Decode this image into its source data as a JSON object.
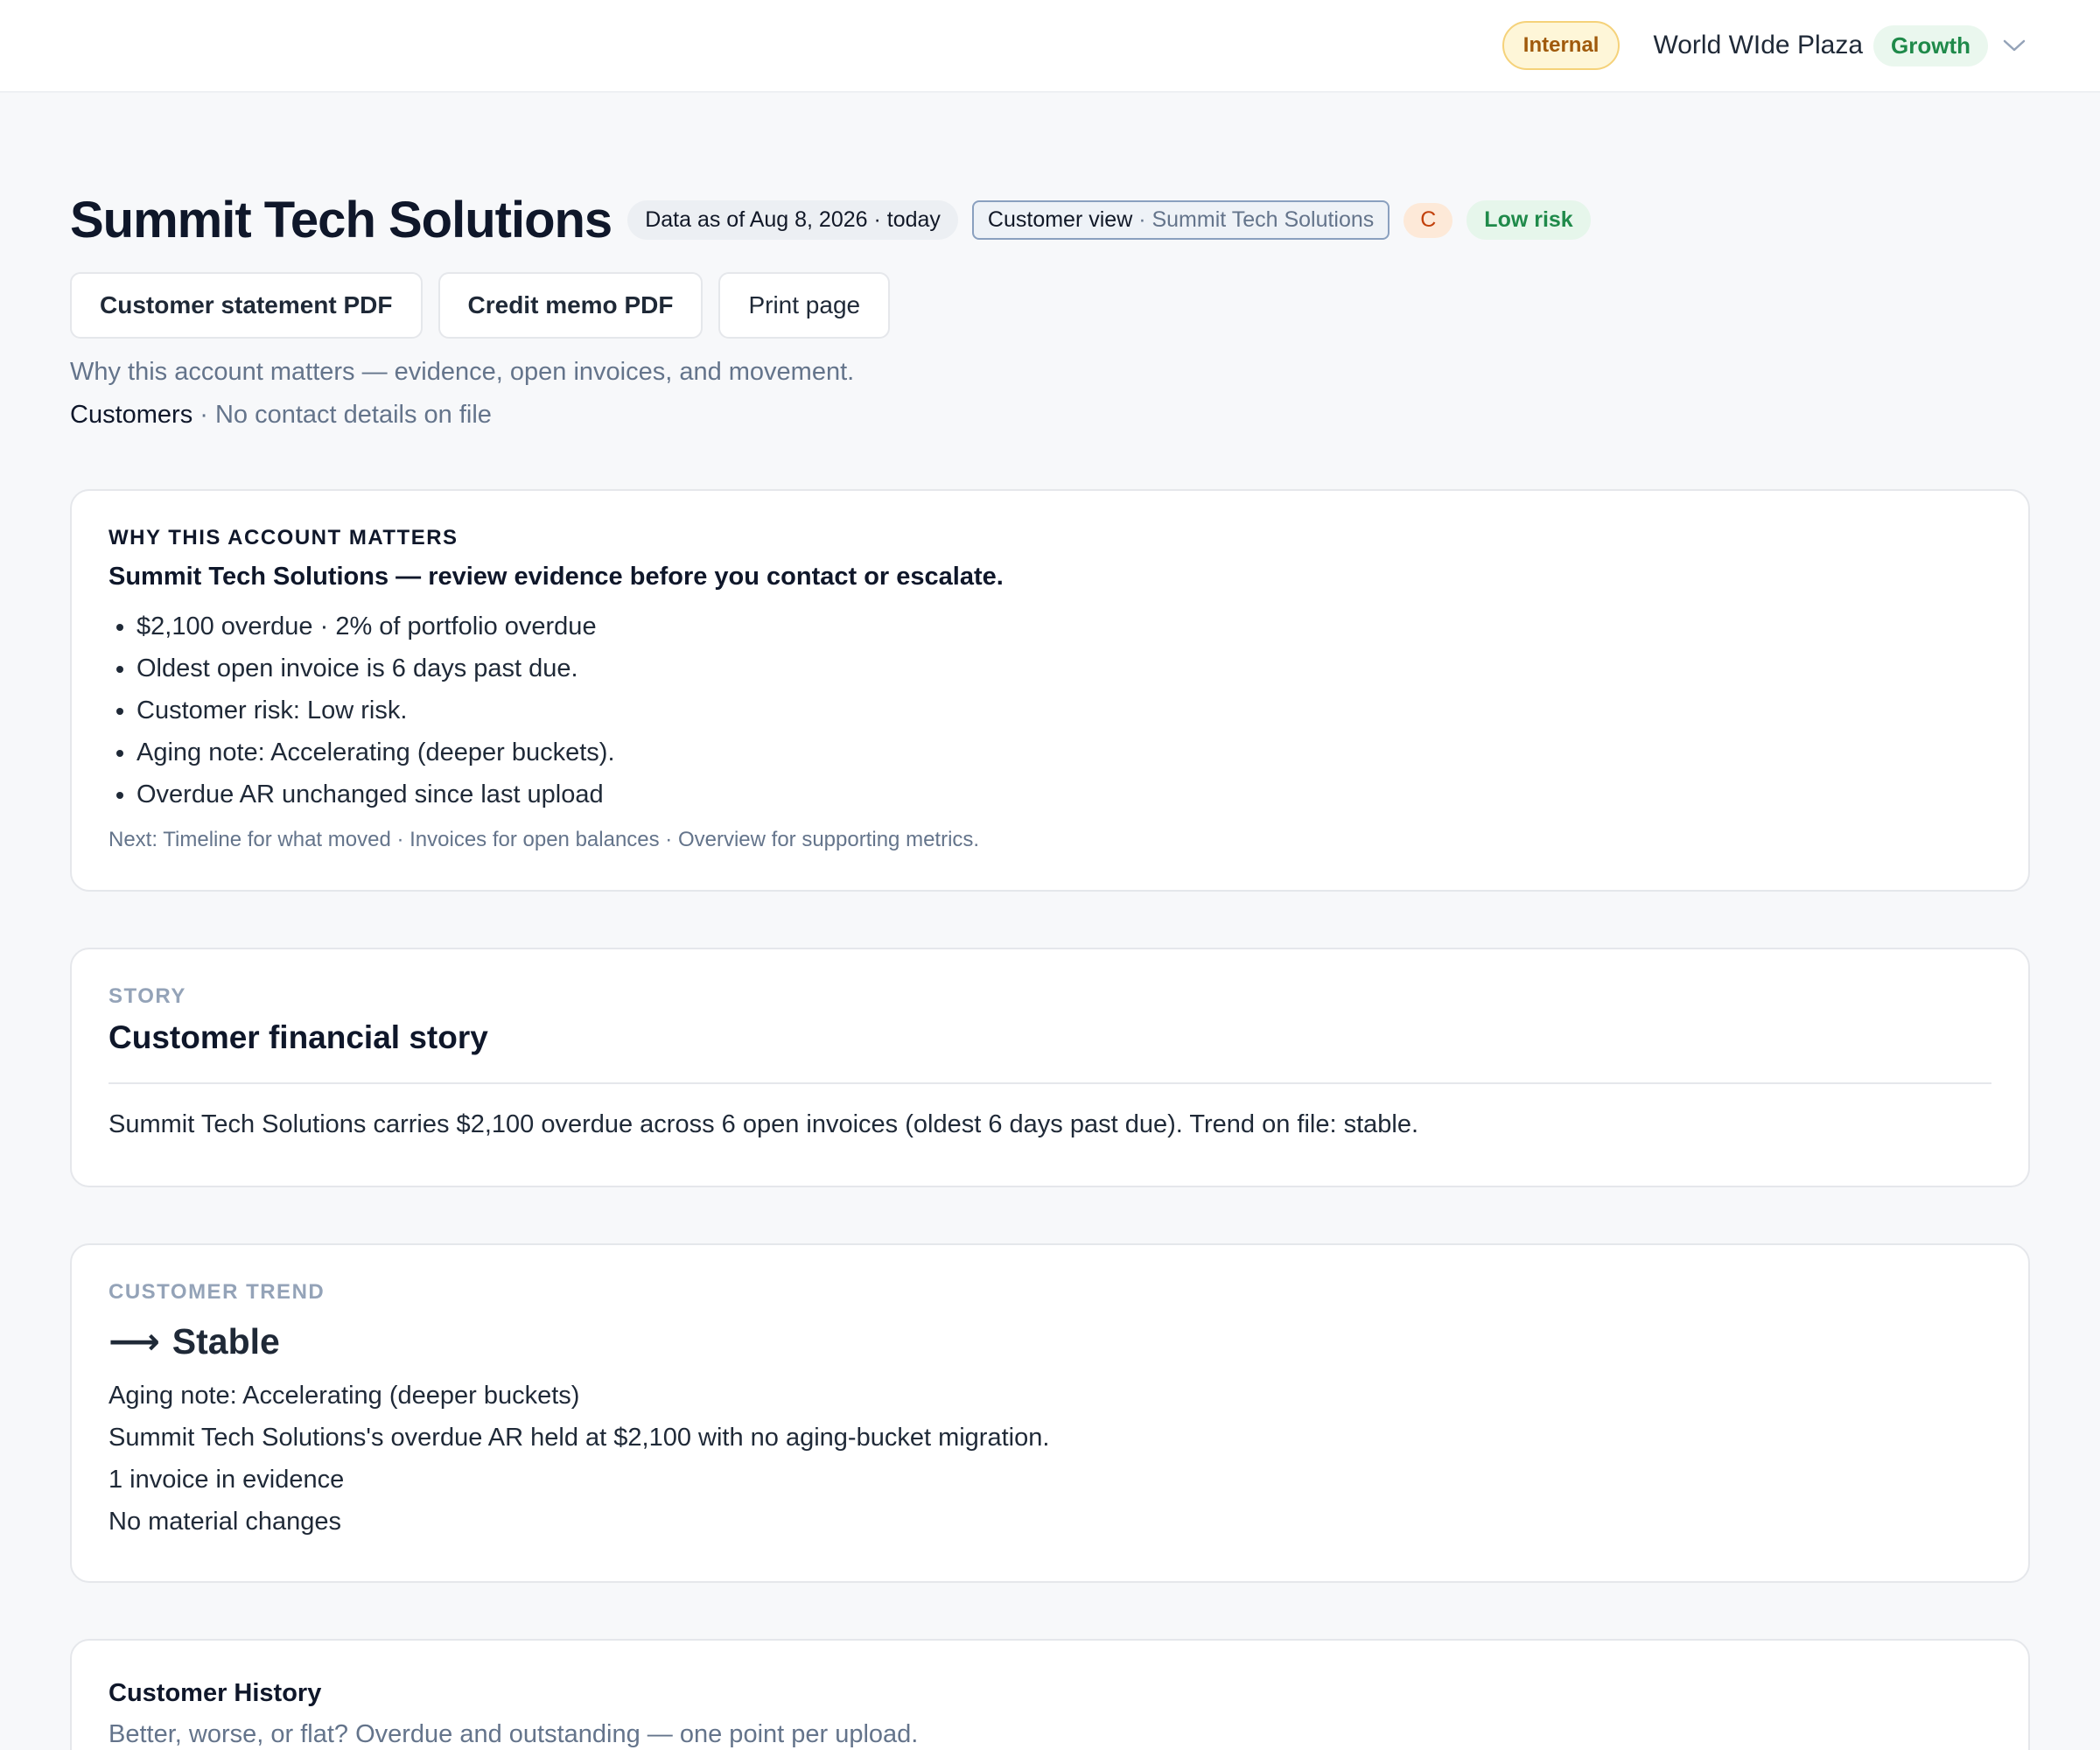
{
  "topbar": {
    "badge": "Internal",
    "org_name": "World WIde Plaza",
    "plan": "Growth",
    "menu_icon": "chevron-down-icon"
  },
  "header": {
    "title": "Summit Tech Solutions",
    "data_as_of": "Data as of Aug 8, 2026 · today",
    "view_label": "Customer view",
    "view_customer": " · Summit Tech Solutions",
    "grade": "C",
    "risk": "Low risk"
  },
  "actions": {
    "statement_pdf": "Customer statement PDF",
    "credit_memo_pdf": "Credit memo PDF",
    "print_page": "Print page"
  },
  "intro": {
    "subtitle": "Why this account matters — evidence, open invoices, and movement.",
    "breadcrumb_link": "Customers",
    "breadcrumb_rest": " · No contact details on file"
  },
  "why": {
    "eyebrow": "WHY THIS ACCOUNT MATTERS",
    "headline": "Summit Tech Solutions — review evidence before you contact or escalate.",
    "bullets": [
      "$2,100 overdue · 2% of portfolio overdue",
      "Oldest open invoice is 6 days past due.",
      "Customer risk: Low risk.",
      "Aging note: Accelerating (deeper buckets).",
      "Overdue AR unchanged since last upload"
    ],
    "next": "Next: Timeline for what moved · Invoices for open balances · Overview for supporting metrics."
  },
  "story": {
    "eyebrow": "STORY",
    "title": "Customer financial story",
    "text": "Summit Tech Solutions carries $2,100 overdue across 6 open invoices (oldest 6 days past due). Trend on file: stable."
  },
  "trend": {
    "eyebrow": "CUSTOMER TREND",
    "arrow": "⟶",
    "title": "Stable",
    "lines": [
      "Aging note: Accelerating (deeper buckets)",
      "Summit Tech Solutions's overdue AR held at $2,100 with no aging-bucket migration.",
      "1 invoice in evidence",
      "No material changes"
    ]
  },
  "history": {
    "title": "Customer History",
    "subtitle": "Better, worse, or flat? Overdue and outstanding — one point per upload."
  }
}
